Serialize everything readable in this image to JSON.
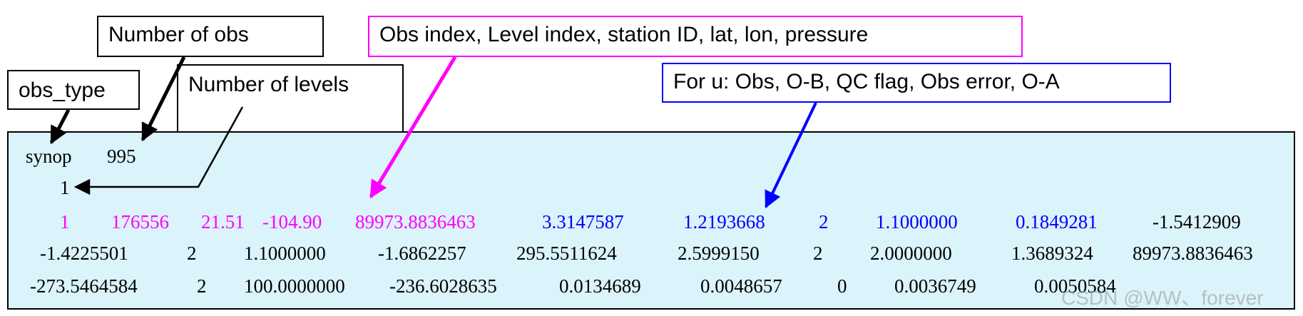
{
  "labels": {
    "obs_type": "obs_type",
    "number_of_obs": "Number of obs",
    "number_of_levels": "Number of levels",
    "obs_index": "Obs index, Level index, station ID, lat, lon, pressure",
    "for_u": "For u: Obs, O-B, QC flag, Obs error, O-A"
  },
  "data": {
    "obs_type_value": "synop",
    "num_obs_value": "995",
    "num_levels_value": "1",
    "row1": [
      "1",
      "176556",
      "21.51",
      "-104.90",
      "89973.8836463",
      "3.3147587",
      "1.2193668",
      "2",
      "1.1000000",
      "0.1849281",
      "-1.5412909"
    ],
    "row2": [
      "-1.4225501",
      "2",
      "1.1000000",
      "-1.6862257",
      "295.5511624",
      "2.5999150",
      "2",
      "2.0000000",
      "1.3689324",
      "89973.8836463"
    ],
    "row3": [
      "-273.5464584",
      "2",
      "100.0000000",
      "-236.6028635",
      "0.0134689",
      "0.0048657",
      "0",
      "0.0036749",
      "0.0050584"
    ]
  },
  "watermark": "CSDN @WW、forever",
  "colors": {
    "panel_background": "#dbf3fb",
    "magenta": "#ff00ff",
    "blue": "#0000ff",
    "black": "#000000"
  }
}
